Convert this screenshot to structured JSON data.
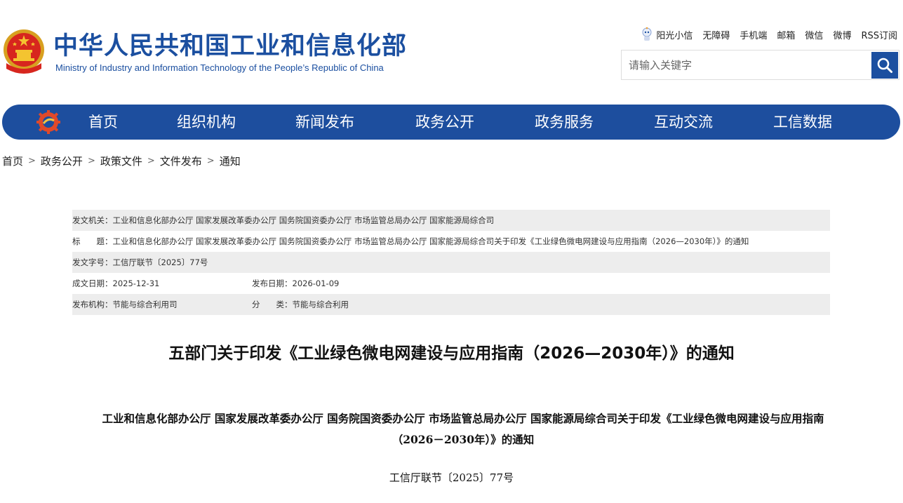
{
  "header": {
    "title_cn": "中华人民共和国工业和信息化部",
    "title_en": "Ministry of Industry and Information Technology of the People’s Republic of China"
  },
  "toplinks": [
    {
      "label": "阳光小信",
      "icon": "robot-icon"
    },
    {
      "label": "无障碍"
    },
    {
      "label": "手机端"
    },
    {
      "label": "邮箱"
    },
    {
      "label": "微信"
    },
    {
      "label": "微博"
    },
    {
      "label": "RSS订阅"
    }
  ],
  "search": {
    "placeholder": "请输入关键字",
    "icon": "search-icon"
  },
  "nav": {
    "items": [
      "首页",
      "组织机构",
      "新闻发布",
      "政务公开",
      "政务服务",
      "互动交流",
      "工信数据"
    ]
  },
  "breadcrumb": [
    "首页",
    "政务公开",
    "政策文件",
    "文件发布",
    "通知"
  ],
  "info": {
    "issuer_label": "发文机关：",
    "issuer": "工业和信息化部办公厅 国家发展改革委办公厅 国务院国资委办公厅 市场监管总局办公厅 国家能源局综合司",
    "title_label": "标　　题：",
    "title": "工业和信息化部办公厅 国家发展改革委办公厅 国务院国资委办公厅 市场监管总局办公厅 国家能源局综合司关于印发《工业绿色微电网建设与应用指南（2026—2030年）》的通知",
    "docno_label": "发文字号：",
    "docno": "工信厅联节〔2025〕77号",
    "date_written_label": "成文日期：",
    "date_written": "2025-12-31",
    "date_published_label": "发布日期：",
    "date_published": "2026-01-09",
    "org_label": "发布机构：",
    "org": "节能与综合利用司",
    "category_label": "分　　类：",
    "category": "节能与综合利用"
  },
  "article": {
    "title": "五部门关于印发《工业绿色微电网建设与应用指南（2026—2030年）》的通知",
    "heading": "工业和信息化部办公厅 国家发展改革委办公厅 国务院国资委办公厅 市场监管总局办公厅 国家能源局综合司关于印发《工业绿色微电网建设与应用指南（2026－2030年）》的通知",
    "doc_number": "工信厅联节〔2025〕77号"
  },
  "colors": {
    "brand_blue": "#1b4fa0",
    "nav_blue": "#1d4e9e",
    "row_shade": "#ededed"
  }
}
